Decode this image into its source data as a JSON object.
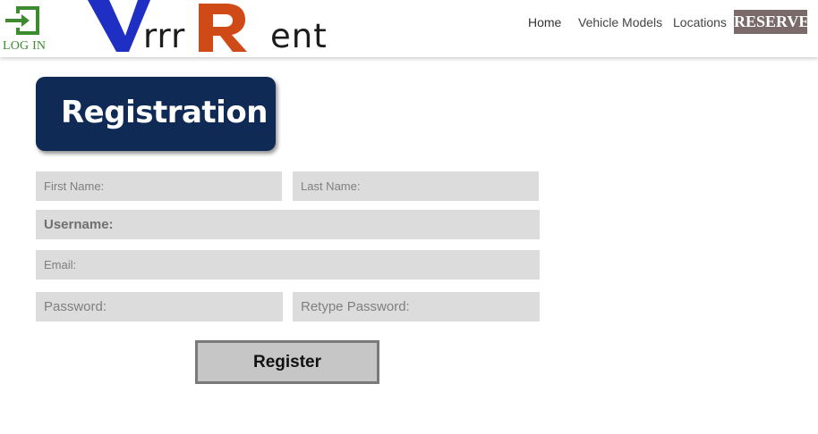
{
  "header": {
    "login_label": "LOG IN",
    "logo_part1": "rrr",
    "logo_part2": "ent",
    "nav": {
      "home": "Home",
      "vehicle_models": "Vehicle Models",
      "locations": "Locations",
      "reserve": "RESERVE"
    }
  },
  "banner": {
    "title": "Registration"
  },
  "form": {
    "first_name_placeholder": "First Name:",
    "last_name_placeholder": "Last Name:",
    "username_placeholder": "Username:",
    "email_placeholder": "Email:",
    "password_placeholder": "Password:",
    "retype_password_placeholder": "Retype Password:",
    "register_label": "Register"
  },
  "colors": {
    "banner_bg": "#0f2a55",
    "reserve_bg": "#7b6a6a",
    "field_bg": "#dcdcdc",
    "logo_blue": "#1f2fc4",
    "logo_orange": "#d04a17",
    "login_green": "#3d8b2f"
  }
}
